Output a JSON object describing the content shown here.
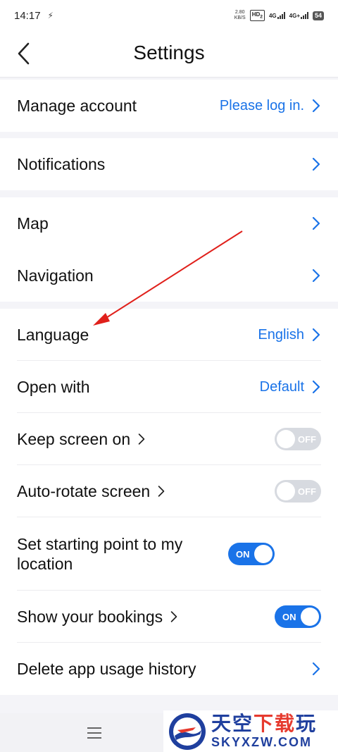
{
  "status_bar": {
    "time": "14:17",
    "net_speed_value": "2.80",
    "net_speed_unit": "KB/S",
    "hd_label": "HD",
    "hd_sim": "2",
    "sig1_label": "4G",
    "sig2_label": "4G+",
    "battery": "54"
  },
  "header": {
    "title": "Settings"
  },
  "sections": {
    "account": {
      "manage_label": "Manage account",
      "manage_value": "Please log in."
    },
    "notifications": {
      "label": "Notifications"
    },
    "map_nav": {
      "map_label": "Map",
      "navigation_label": "Navigation"
    },
    "general": {
      "language_label": "Language",
      "language_value": "English",
      "open_with_label": "Open with",
      "open_with_value": "Default",
      "keep_screen_label": "Keep screen on",
      "keep_screen_state": "OFF",
      "auto_rotate_label": "Auto-rotate screen",
      "auto_rotate_state": "OFF",
      "start_point_label": "Set starting point to my location",
      "start_point_state": "ON",
      "bookings_label": "Show your bookings",
      "bookings_state": "ON",
      "delete_history_label": "Delete app usage history"
    }
  },
  "watermark": {
    "cn_blue": "天空",
    "cn_red": "下载",
    "cn_blue2": "玩",
    "en": "SKYXZW.COM"
  },
  "colors": {
    "accent": "#1a73e8",
    "toggle_off": "#d7dae0",
    "annotation": "#e0201b",
    "background": "#f4f4f8"
  },
  "icons": {
    "back": "chevron-left-icon",
    "row_arrow": "chevron-right-icon",
    "menu": "hamburger-menu-icon"
  }
}
